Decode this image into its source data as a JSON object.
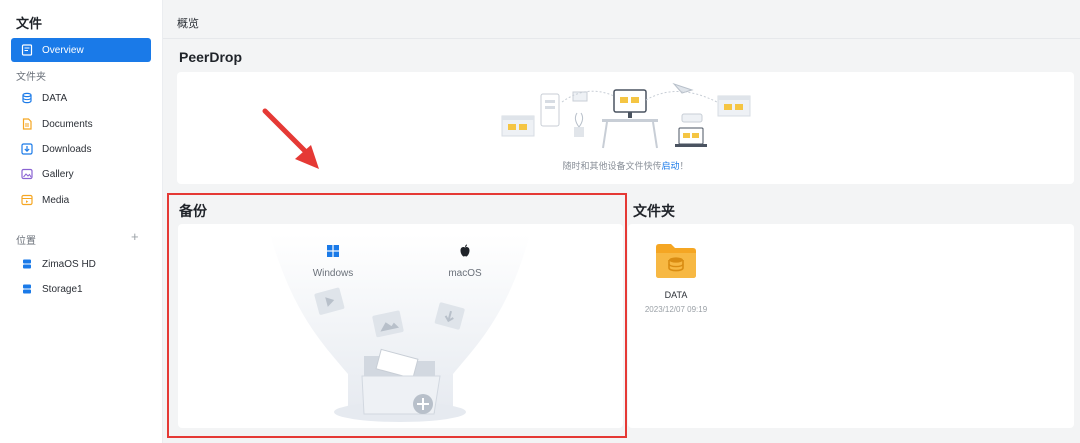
{
  "sidebar": {
    "title": "文件",
    "overview": "Overview",
    "folders_label": "文件夹",
    "folders": [
      "DATA",
      "Documents",
      "Downloads",
      "Gallery",
      "Media"
    ],
    "location_label": "位置",
    "add_icon": "+",
    "locations": [
      "ZimaOS HD",
      "Storage1"
    ]
  },
  "header": {
    "breadcrumb": "概览"
  },
  "peerdrop": {
    "title": "PeerDrop",
    "hint": "随时和其他设备文件快传",
    "link": "启动",
    "suffix": "！"
  },
  "backup": {
    "title": "备份",
    "os": [
      "Windows",
      "macOS"
    ]
  },
  "folders": {
    "title": "文件夹",
    "items": [
      {
        "name": "DATA",
        "date": "2023/12/07 09:19"
      }
    ]
  },
  "colors": {
    "accent": "#1a7ae8",
    "highlight": "#e53935",
    "folder": "#f5a623"
  }
}
